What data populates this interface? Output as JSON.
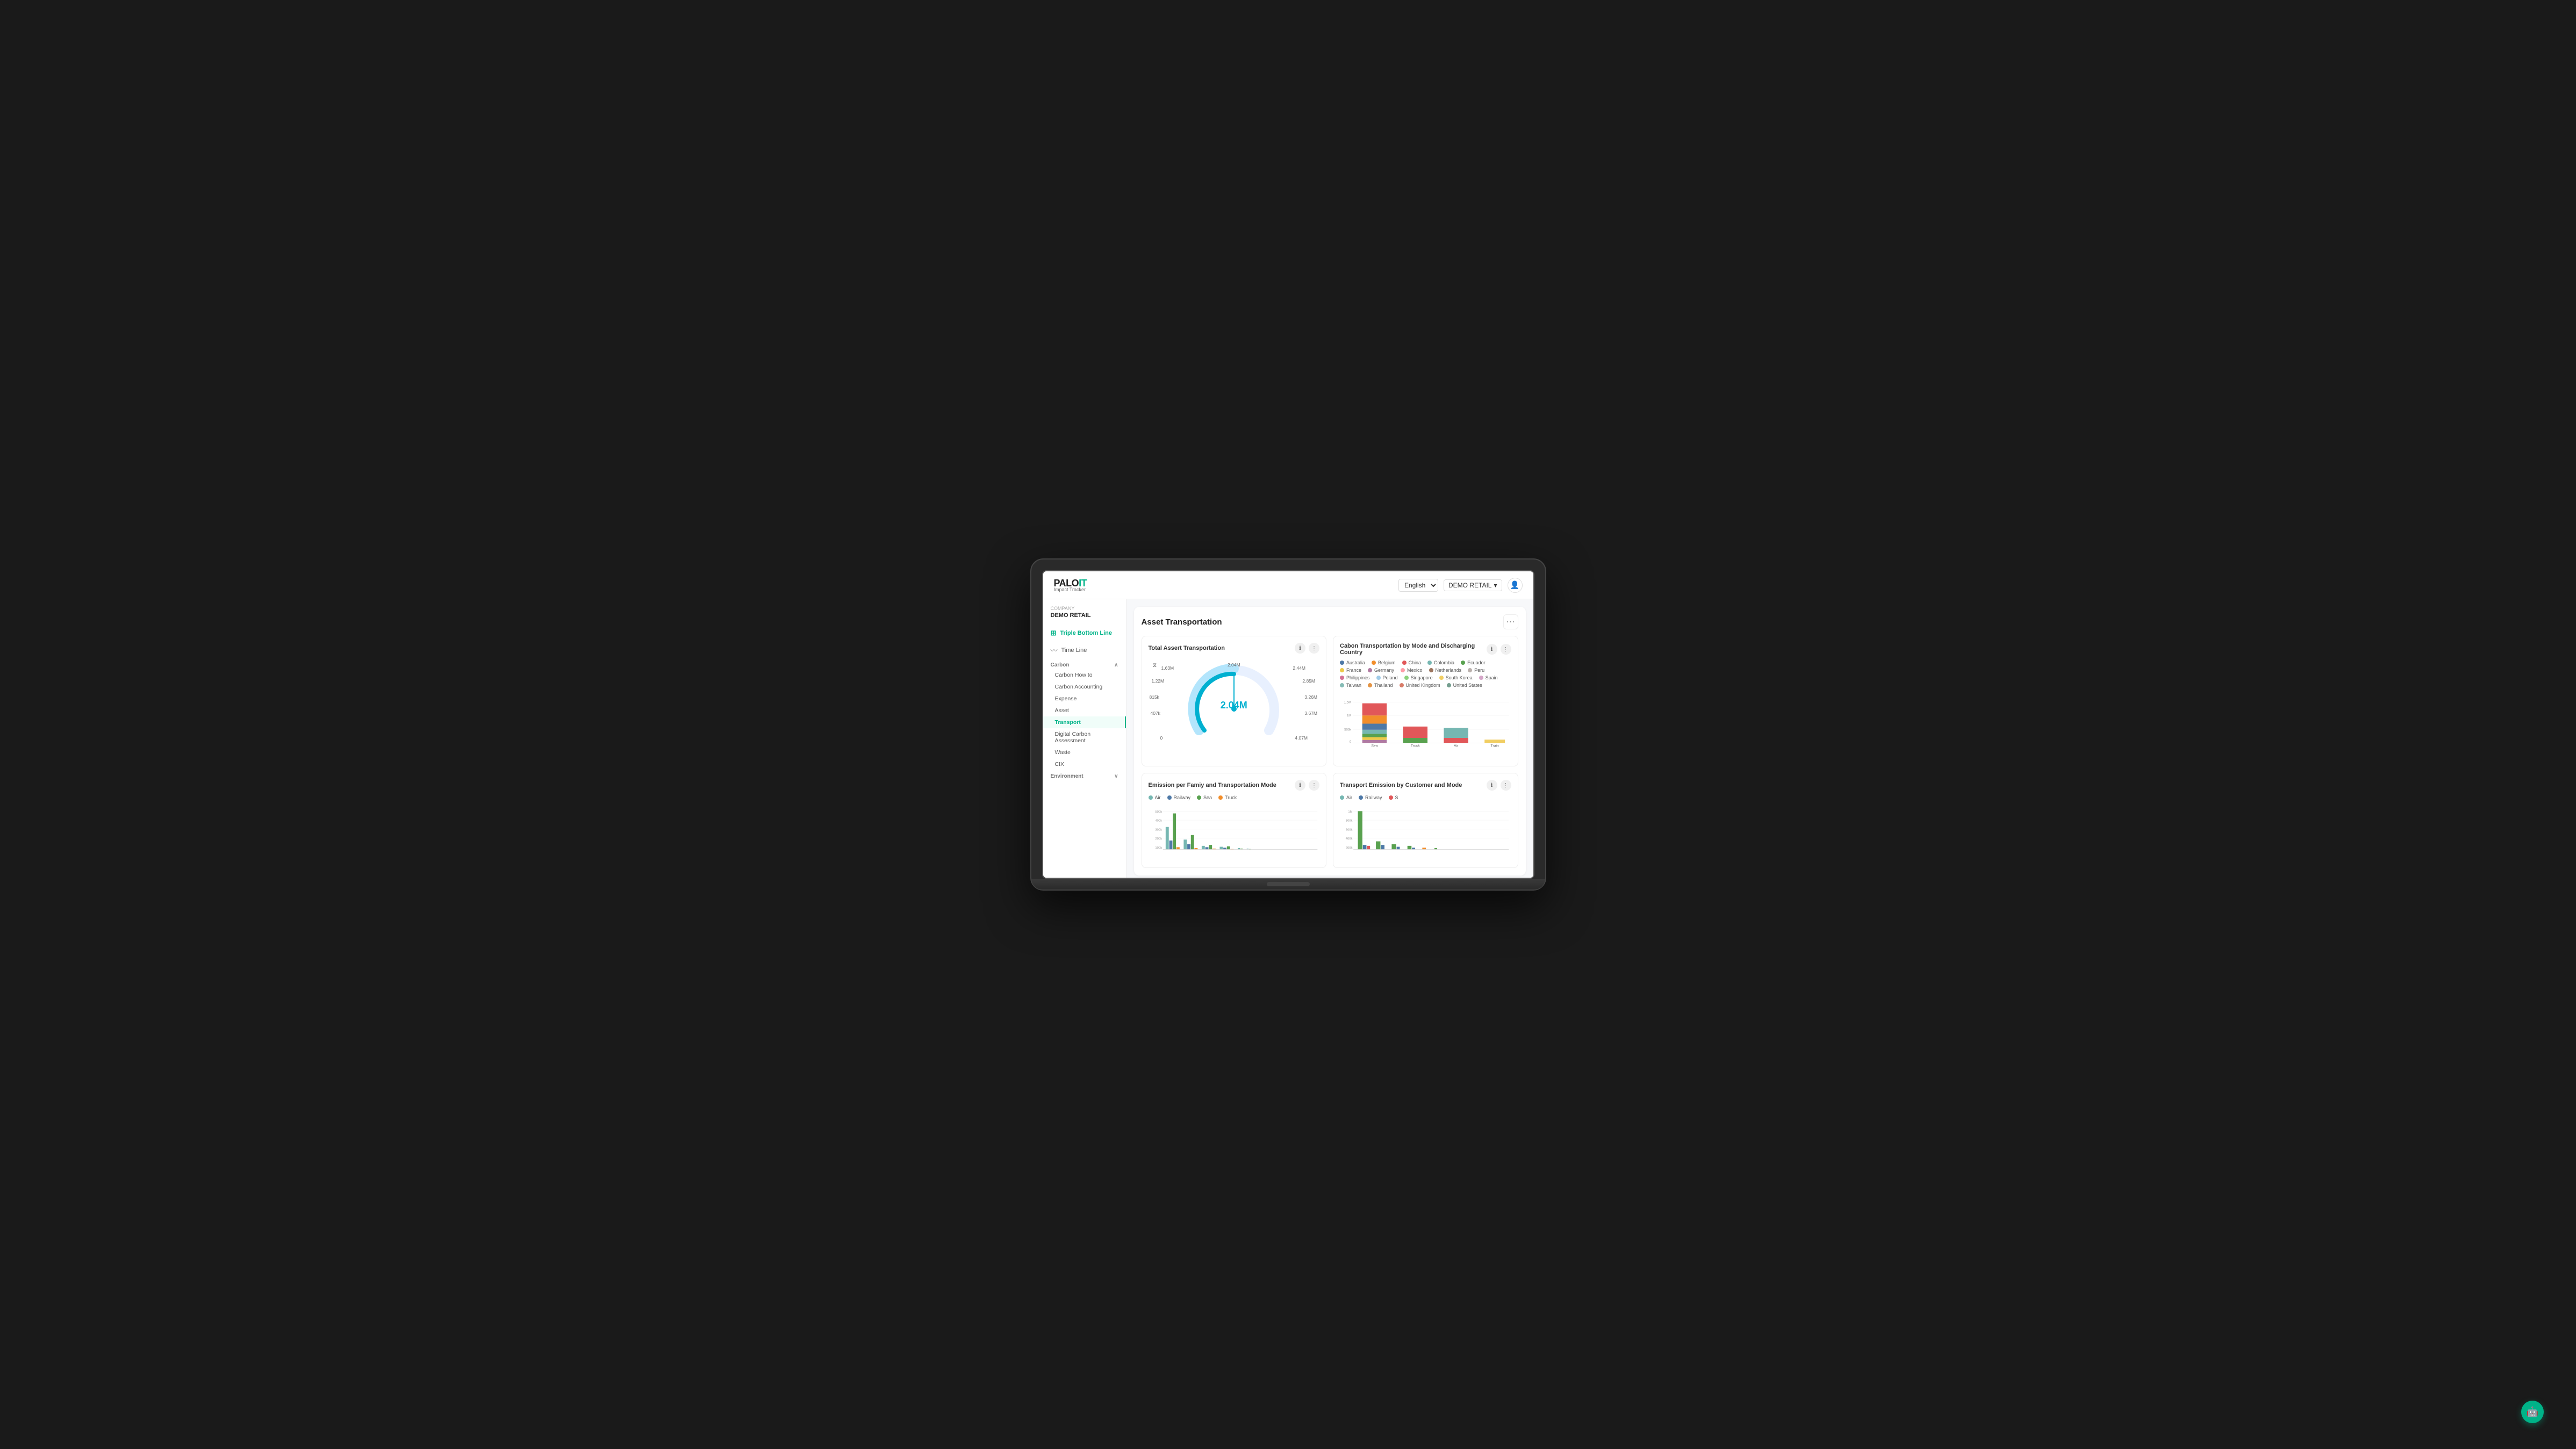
{
  "app": {
    "logo_palo": "PALO",
    "logo_it": "IT",
    "logo_sub": "Impact Tracker"
  },
  "topbar": {
    "lang_label": "English",
    "demo_label": "DEMO RETAIL",
    "user_icon": "👤"
  },
  "sidebar": {
    "company_label": "Company",
    "company_name": "DEMO RETAIL",
    "nav": [
      {
        "id": "triple-bottom-line",
        "label": "Triple Bottom Line",
        "icon": "☰",
        "active": true
      },
      {
        "id": "time-line",
        "label": "Time Line",
        "icon": "〰",
        "active": false
      }
    ],
    "sections": [
      {
        "id": "carbon",
        "label": "Carbon",
        "expanded": true,
        "items": [
          {
            "id": "carbon-how-to",
            "label": "Carbon How to",
            "active": false
          },
          {
            "id": "carbon-accounting",
            "label": "Carbon Accounting",
            "active": false
          },
          {
            "id": "expense",
            "label": "Expense",
            "active": false
          },
          {
            "id": "asset",
            "label": "Asset",
            "active": false
          },
          {
            "id": "transport",
            "label": "Transport",
            "active": true
          },
          {
            "id": "digital-carbon",
            "label": "Digital Carbon Assessment",
            "active": false
          },
          {
            "id": "waste",
            "label": "Waste",
            "active": false
          },
          {
            "id": "cix",
            "label": "CIX",
            "active": false
          }
        ]
      },
      {
        "id": "environment",
        "label": "Environment",
        "expanded": false,
        "items": []
      }
    ]
  },
  "page": {
    "title": "Asset Transportation",
    "more_dots": "⋯"
  },
  "gauge_chart": {
    "title": "Total Assert Transportation",
    "center_value": "2.04M",
    "labels": {
      "top": "2.04M",
      "top_right": "2.44M",
      "right_top": "2.85M",
      "right_mid": "3.26M",
      "right_bot": "3.67M",
      "bot": "4.07M",
      "bot_left": "0",
      "left_bot": "407k",
      "left_mid": "815k",
      "left_top": "1.22M",
      "top_left": "1.63M"
    }
  },
  "bar_chart": {
    "title": "Cabon Transportation by Mode and Discharging Country",
    "legend": [
      {
        "label": "Australia",
        "color": "#4e79a7"
      },
      {
        "label": "Belgium",
        "color": "#f28e2b"
      },
      {
        "label": "China",
        "color": "#e15759"
      },
      {
        "label": "Colombia",
        "color": "#76b7b2"
      },
      {
        "label": "Ecuador",
        "color": "#59a14f"
      },
      {
        "label": "France",
        "color": "#edc948"
      },
      {
        "label": "Germany",
        "color": "#b07aa1"
      },
      {
        "label": "Mexico",
        "color": "#ff9da7"
      },
      {
        "label": "Netherlands",
        "color": "#9c755f"
      },
      {
        "label": "Peru",
        "color": "#bab0ac"
      },
      {
        "label": "Philippines",
        "color": "#d37295"
      },
      {
        "label": "Poland",
        "color": "#a0cbe8"
      },
      {
        "label": "Singapore",
        "color": "#8cd17d"
      },
      {
        "label": "South Korea",
        "color": "#f1ce63"
      },
      {
        "label": "Spain",
        "color": "#d4a6c8"
      },
      {
        "label": "Taiwan",
        "color": "#86bcb6"
      },
      {
        "label": "Thailand",
        "color": "#e49444"
      },
      {
        "label": "United Kingdom",
        "color": "#d87c68"
      },
      {
        "label": "United States",
        "color": "#749e8e"
      }
    ],
    "y_max": "1.5M",
    "y_mid": "1M",
    "y_low": "500k",
    "x_labels": [
      "Sea",
      "Truck",
      "Air",
      "Train"
    ],
    "bars": [
      {
        "label": "Sea",
        "height_pct": 95,
        "colors": [
          "#e15759",
          "#f28e2b",
          "#4e79a7",
          "#76b7b2",
          "#59a14f",
          "#edc948",
          "#b07aa1"
        ]
      },
      {
        "label": "Truck",
        "height_pct": 35,
        "colors": [
          "#e15759",
          "#59a14f"
        ]
      },
      {
        "label": "Air",
        "height_pct": 32,
        "colors": [
          "#76b7b2",
          "#e15759"
        ]
      },
      {
        "label": "Train",
        "height_pct": 8,
        "colors": [
          "#f1ce63"
        ]
      }
    ]
  },
  "emission_chart": {
    "title": "Emission per Famiy and Transportation Mode",
    "legend": [
      {
        "label": "Air",
        "color": "#76b7b2"
      },
      {
        "label": "Railway",
        "color": "#4e79a7"
      },
      {
        "label": "Sea",
        "color": "#59a14f"
      },
      {
        "label": "Truck",
        "color": "#f28e2b"
      }
    ],
    "y_labels": [
      "500k",
      "400k",
      "300k",
      "200k",
      "100k",
      "0"
    ],
    "groups": [
      {
        "bars": [
          60,
          20,
          80,
          10
        ]
      },
      {
        "bars": [
          20,
          10,
          40,
          5
        ]
      },
      {
        "bars": [
          5,
          3,
          8,
          2
        ]
      },
      {
        "bars": [
          3,
          2,
          5,
          1
        ]
      },
      {
        "bars": [
          2,
          1,
          3,
          1
        ]
      },
      {
        "bars": [
          1,
          1,
          2,
          0
        ]
      },
      {
        "bars": [
          1,
          0,
          1,
          0
        ]
      },
      {
        "bars": [
          1,
          0,
          1,
          0
        ]
      }
    ]
  },
  "transport_emission_chart": {
    "title": "Transport Emission by Customer and Mode",
    "legend": [
      {
        "label": "Air",
        "color": "#76b7b2"
      },
      {
        "label": "Railway",
        "color": "#4e79a7"
      },
      {
        "label": "Sea",
        "color": "#59a14f"
      }
    ],
    "y_labels": [
      "1M",
      "800k",
      "600k",
      "400k",
      "200k"
    ],
    "bars": [
      {
        "heights": [
          85,
          5,
          3
        ]
      },
      {
        "heights": [
          15,
          8,
          2
        ]
      },
      {
        "heights": [
          8,
          3,
          1
        ]
      },
      {
        "heights": [
          5,
          2,
          1
        ]
      },
      {
        "heights": [
          3,
          1,
          0
        ]
      },
      {
        "heights": [
          2,
          1,
          0
        ]
      }
    ]
  }
}
